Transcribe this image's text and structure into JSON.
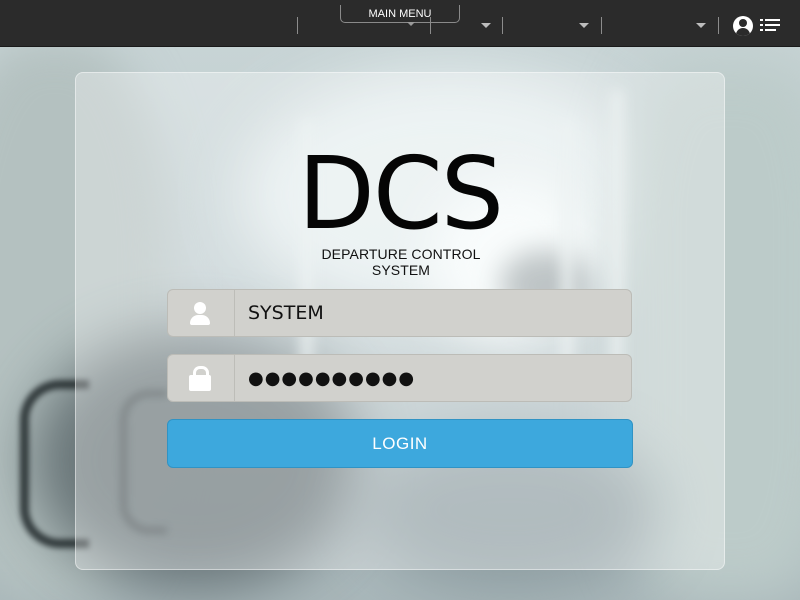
{
  "navbar": {
    "main_menu_label": "MAIN MENU",
    "dropdowns": [
      "",
      "",
      ""
    ],
    "icons": {
      "user": "user-circle-icon",
      "menu": "list-menu-icon"
    }
  },
  "login": {
    "logo": "DCS",
    "subtitle": "DEPARTURE CONTROL SYSTEM",
    "username": {
      "value": "SYSTEM",
      "icon": "person-icon"
    },
    "password": {
      "value": "●●●●●●●●●●",
      "icon": "lock-icon"
    },
    "button_label": "LOGIN"
  },
  "colors": {
    "navbar": "#2b2b2b",
    "accent": "#3da8dd",
    "field": "#d1d1cd"
  }
}
